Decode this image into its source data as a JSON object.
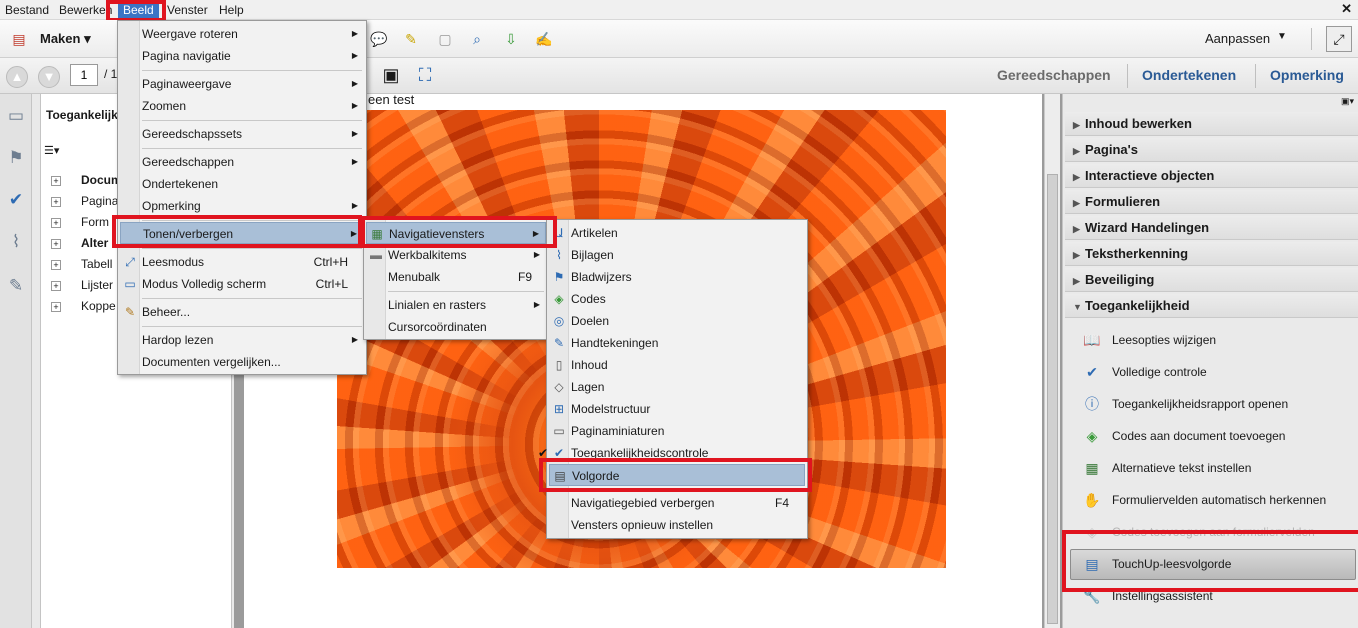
{
  "menubar": {
    "bestand": "Bestand",
    "bewerken": "Bewerken",
    "beeld": "Beeld",
    "venster": "Venster",
    "help": "Help",
    "close": "✕"
  },
  "toolbar1": {
    "maken": "Maken",
    "aanpassen": "Aanpassen"
  },
  "toolbar2": {
    "page_value": "1",
    "page_total": "/ 1",
    "panes": [
      "Gereedschappen",
      "Ondertekenen",
      "Opmerking"
    ]
  },
  "left_panel": {
    "title": "Toegankelijk",
    "items": [
      "Docum",
      "Pagina",
      "Form",
      "Alter",
      "Tabell",
      "Lijster",
      "Koppe"
    ]
  },
  "document": {
    "visible_text": "een test"
  },
  "right_panel": {
    "sections": [
      "Inhoud bewerken",
      "Pagina's",
      "Interactieve objecten",
      "Formulieren",
      "Wizard Handelingen",
      "Tekstherkenning",
      "Beveiliging",
      "Toegankelijkheid"
    ],
    "tools": [
      "Leesopties wijzigen",
      "Volledige controle",
      "Toegankelijkheidsrapport openen",
      "Codes aan document toevoegen",
      "Alternatieve tekst instellen",
      "Formuliervelden automatisch herkennen",
      "Codes toevoegen aan formuliervelden",
      "TouchUp-leesvolgorde",
      "Instellingsassistent"
    ]
  },
  "menu_beeld": {
    "items": [
      "Weergave roteren",
      "Pagina navigatie",
      "Paginaweergave",
      "Zoomen",
      "Gereedschapssets",
      "Gereedschappen",
      "Ondertekenen",
      "Opmerking",
      "Tonen/verbergen",
      "Leesmodus",
      "Modus Volledig scherm",
      "Beheer...",
      "Hardop lezen",
      "Documenten vergelijken..."
    ],
    "shortcuts": {
      "leesmodus": "Ctrl+H",
      "volledig": "Ctrl+L"
    }
  },
  "menu_tonen": {
    "items": [
      "Navigatievensters",
      "Werkbalkitems",
      "Menubalk",
      "Linialen en rasters",
      "Cursorcoördinaten"
    ],
    "shortcuts": {
      "menubalk": "F9"
    }
  },
  "menu_nav": {
    "items": [
      "Artikelen",
      "Bijlagen",
      "Bladwijzers",
      "Codes",
      "Doelen",
      "Handtekeningen",
      "Inhoud",
      "Lagen",
      "Modelstructuur",
      "Paginaminiaturen",
      "Toegankelijkheidscontrole",
      "Volgorde",
      "Navigatiegebied verbergen",
      "Vensters opnieuw instellen"
    ],
    "shortcuts": {
      "verbergen": "F4"
    },
    "check": "✔"
  },
  "colors": {
    "highlight_red": "#e0141f",
    "menu_highlight": "#a9bfd7",
    "accent_blue": "#2e6bb3"
  }
}
